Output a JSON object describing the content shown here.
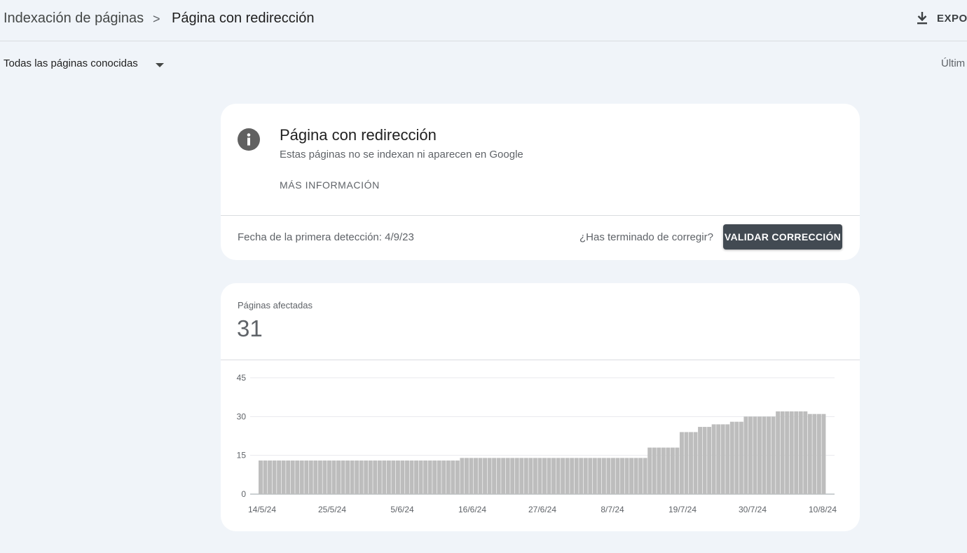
{
  "header": {
    "breadcrumb_parent": "Indexación de páginas",
    "breadcrumb_separator": ">",
    "breadcrumb_current": "Página con redirección",
    "export_label": "EXPOR",
    "export_icon": "download-icon"
  },
  "filter": {
    "selected": "Todas las páginas conocidas",
    "range_label": "Últim"
  },
  "issue_card": {
    "icon": "info-icon",
    "title": "Página con redirección",
    "subtitle": "Estas páginas no se indexan ni aparecen en Google",
    "more_info": "MÁS INFORMACIÓN",
    "first_detected": "Fecha de la primera detección: 4/9/23",
    "done_question": "¿Has terminado de corregir?",
    "validate_label": "VALIDAR CORRECCIÓN"
  },
  "affected_card": {
    "label": "Páginas afectadas",
    "value": "31"
  },
  "colors": {
    "background": "#f0f4f9",
    "bar": "#bdbdbd",
    "button": "#424a52"
  },
  "chart_data": {
    "type": "bar",
    "title": "",
    "xlabel": "",
    "ylabel": "",
    "ylim": [
      0,
      45
    ],
    "yticks": [
      0,
      15,
      30,
      45
    ],
    "grid": true,
    "x_tick_labels": [
      "14/5/24",
      "25/5/24",
      "5/6/24",
      "16/6/24",
      "27/6/24",
      "8/7/24",
      "19/7/24",
      "30/7/24",
      "10/8/24"
    ],
    "values": [
      13,
      13,
      13,
      13,
      13,
      13,
      13,
      13,
      13,
      13,
      13,
      13,
      13,
      13,
      13,
      13,
      13,
      13,
      13,
      13,
      13,
      13,
      13,
      13,
      13,
      13,
      13,
      13,
      13,
      13,
      13,
      13,
      13,
      13,
      13,
      13,
      13,
      13,
      13,
      13,
      13,
      13,
      13,
      13,
      14,
      14,
      14,
      14,
      14,
      14,
      14,
      14,
      14,
      14,
      14,
      14,
      14,
      14,
      14,
      14,
      14,
      14,
      14,
      14,
      14,
      14,
      14,
      14,
      14,
      14,
      14,
      14,
      14,
      14,
      14,
      14,
      14,
      14,
      14,
      14,
      14,
      14,
      14,
      14,
      14,
      18,
      18,
      18,
      18,
      18,
      18,
      18,
      24,
      24,
      24,
      24,
      26,
      26,
      26,
      27,
      27,
      27,
      27,
      28,
      28,
      28,
      30,
      30,
      30,
      30,
      30,
      30,
      30,
      32,
      32,
      32,
      32,
      32,
      32,
      32,
      31,
      31,
      31,
      31
    ]
  }
}
